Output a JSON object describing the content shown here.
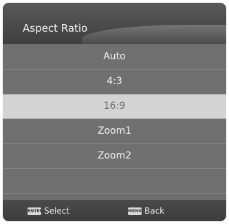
{
  "menu": {
    "title": "Aspect Ratio",
    "options": [
      "Auto",
      "4:3",
      "16:9",
      "Zoom1",
      "Zoom2"
    ],
    "selected_index": 2
  },
  "footer": {
    "select": {
      "key": "ENTER",
      "label": "Select"
    },
    "back": {
      "key": "MENU",
      "label": "Back"
    }
  }
}
